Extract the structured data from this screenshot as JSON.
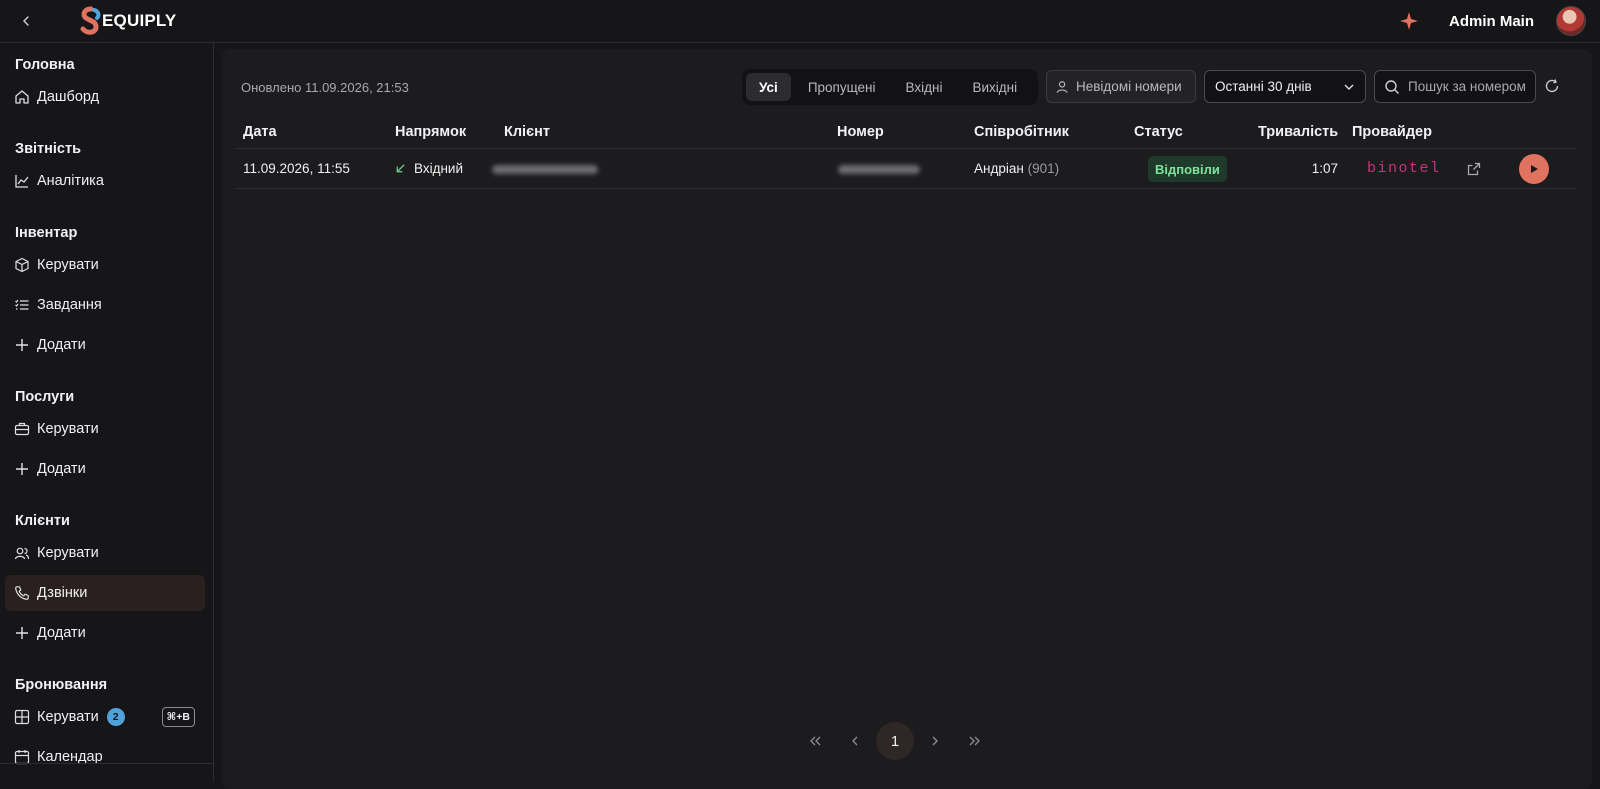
{
  "header": {
    "logo_text": "EQUIPLY",
    "user_name": "Admin Main"
  },
  "sidebar": {
    "sections": [
      {
        "title": "Головна",
        "items": [
          {
            "label": "Дашборд",
            "icon": "home-icon"
          }
        ]
      },
      {
        "title": "Звітність",
        "items": [
          {
            "label": "Аналітика",
            "icon": "chart-line-icon"
          }
        ]
      },
      {
        "title": "Інвентар",
        "items": [
          {
            "label": "Керувати",
            "icon": "box-icon"
          },
          {
            "label": "Завдання",
            "icon": "list-checks-icon"
          },
          {
            "label": "Додати",
            "icon": "plus-icon"
          }
        ]
      },
      {
        "title": "Послуги",
        "items": [
          {
            "label": "Керувати",
            "icon": "briefcase-icon"
          },
          {
            "label": "Додати",
            "icon": "plus-icon"
          }
        ]
      },
      {
        "title": "Клієнти",
        "items": [
          {
            "label": "Керувати",
            "icon": "users-icon"
          },
          {
            "label": "Дзвінки",
            "icon": "phone-icon",
            "active": true
          },
          {
            "label": "Додати",
            "icon": "plus-icon"
          }
        ]
      },
      {
        "title": "Бронювання",
        "items": [
          {
            "label": "Керувати",
            "icon": "grid-icon",
            "badge": "2",
            "shortcut": "⌘+B"
          },
          {
            "label": "Календар",
            "icon": "calendar-icon"
          }
        ]
      }
    ]
  },
  "toolbar": {
    "updated": "Оновлено 11.09.2026, 21:53",
    "filters": [
      "Усі",
      "Пропущені",
      "Вхідні",
      "Вихідні"
    ],
    "selected_filter": "Усі",
    "unknown_numbers": "Невідомі номери",
    "range": "Останні 30 днів",
    "search_placeholder": "Пошук за номером"
  },
  "table": {
    "columns": [
      "Дата",
      "Напрямок",
      "Клієнт",
      "Номер",
      "Співробітник",
      "Статус",
      "Тривалість",
      "Провайдер"
    ],
    "rows": [
      {
        "date": "11.09.2026, 11:55",
        "direction": "Вхідний",
        "employee": "Андріан",
        "employee_ext": "(901)",
        "status": "Відповіли",
        "duration": "1:07",
        "provider": "binotel"
      }
    ]
  },
  "pagination": {
    "current": "1"
  },
  "colors": {
    "accent": "#e0735f",
    "status_ok": "#7ee29b",
    "badge": "#4fa3d9",
    "provider": "#c2357c"
  }
}
